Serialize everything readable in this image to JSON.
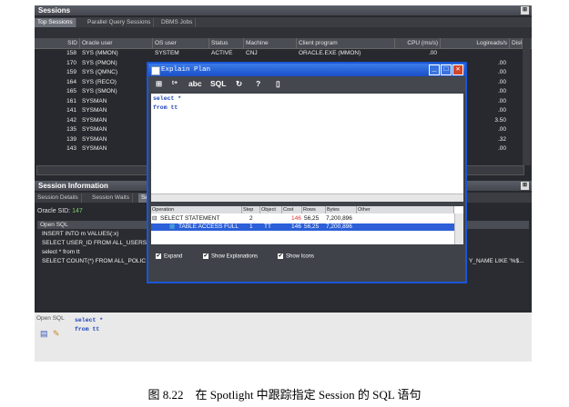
{
  "sessions_panel": {
    "title": "Sessions",
    "pin": "⊞",
    "tabs": [
      "Top Sessions",
      "Parallel Query Sessions",
      "DBMS Jobs"
    ],
    "columns": [
      "SID",
      "Oracle user",
      "OS user",
      "Status",
      "Machine",
      "Client program",
      "CPU (ms/s)",
      "Logireads/s",
      "Disk"
    ],
    "rows": [
      {
        "sid": "158",
        "user": "SYS (MMON)",
        "os": "SYSTEM",
        "status": "ACTIVE",
        "machine": "CNJ",
        "program": "ORACLE.EXE (MMON)",
        "cpu": "00",
        ".log": ".00"
      },
      {
        "sid": "170",
        "user": "SYS (PMON)",
        "os": "",
        "status": "",
        "machine": "",
        "program": "",
        "cpu": "",
        "log": ".00"
      },
      {
        "sid": "159",
        "user": "SYS (QMNC)",
        "os": "",
        "status": "",
        "machine": "",
        "program": "",
        "cpu": "",
        "log": ".00"
      },
      {
        "sid": "164",
        "user": "SYS (RECO)",
        "os": "",
        "status": "",
        "machine": "",
        "program": "",
        "cpu": "",
        "log": ".00"
      },
      {
        "sid": "165",
        "user": "SYS (SMON)",
        "os": "",
        "status": "",
        "machine": "",
        "program": "",
        "cpu": "",
        "log": ".00"
      },
      {
        "sid": "161",
        "user": "SYSMAN",
        "os": "",
        "status": "",
        "machine": "",
        "program": "",
        "cpu": "",
        "log": ".00"
      },
      {
        "sid": "141",
        "user": "SYSMAN",
        "os": "",
        "status": "",
        "machine": "",
        "program": "",
        "cpu": "",
        "log": ".00"
      },
      {
        "sid": "142",
        "user": "SYSMAN",
        "os": "",
        "status": "",
        "machine": "",
        "program": "",
        "cpu": "",
        "log": "3.50"
      },
      {
        "sid": "135",
        "user": "SYSMAN",
        "os": "",
        "status": "",
        "machine": "",
        "program": "",
        "cpu": "",
        "log": ".00"
      },
      {
        "sid": "139",
        "user": "SYSMAN",
        "os": "",
        "status": "",
        "machine": "",
        "program": "",
        "cpu": "",
        "log": ".32"
      },
      {
        "sid": "143",
        "user": "SYSMAN",
        "os": "",
        "status": "",
        "machine": "",
        "program": "",
        "cpu": "",
        "log": ".00"
      }
    ],
    "first_row_cpu": ".00"
  },
  "session_info": {
    "title": "Session Information",
    "pin": "⊞",
    "tabs": [
      "Session Details",
      "Session Waits",
      "Se"
    ],
    "oracle_sid_label": "Oracle SID:",
    "oracle_sid_value": "147",
    "open_sql_header": "Open SQL",
    "sql_lines": [
      "INSERT INTO m VALUES(:x)",
      "SELECT USER_ID FROM ALL_USERS",
      "select * from tt",
      "SELECT COUNT(*) FROM ALL_POLIC"
    ],
    "sql_right_fragment": "Y_NAME LIKE '%$...",
    "open_sql_label": "Open SQL",
    "open_sql_code": [
      "select *",
      "from tt"
    ]
  },
  "explain_dialog": {
    "title": "Explain Plan",
    "toolbar": {
      "grid": "⊞",
      "tree": "ᵗ⁺",
      "abc": "abc",
      "sql": "SQL",
      "refresh": "↻",
      "help": "?",
      "clip": "▯"
    },
    "editor_lines": [
      "select *",
      "from tt"
    ],
    "plan_columns": [
      "Operation",
      "Step",
      "Object",
      "Cost",
      "Rows",
      "Bytes",
      "Other"
    ],
    "plan_rows": [
      {
        "op": "SELECT STATEMENT",
        "step": "2",
        "object": "",
        "cost": "146",
        "rows": "56,25",
        "bytes": "7,200,896"
      },
      {
        "op": "TABLE ACCESS FULL",
        "step": "1",
        "object": "TT",
        "cost": "146",
        "rows": "56,25",
        "bytes": "7,200,896"
      }
    ],
    "options": [
      "Expand",
      "Show Explanations",
      "Show Icons"
    ],
    "check": "✔"
  },
  "caption": "图 8.22　在 Spotlight 中跟踪指定 Session 的 SQL 语句",
  "colors": {
    "accent": "#1a56d6",
    "sid_value": "#7fd16a",
    "plan_cost": "#e03030"
  }
}
